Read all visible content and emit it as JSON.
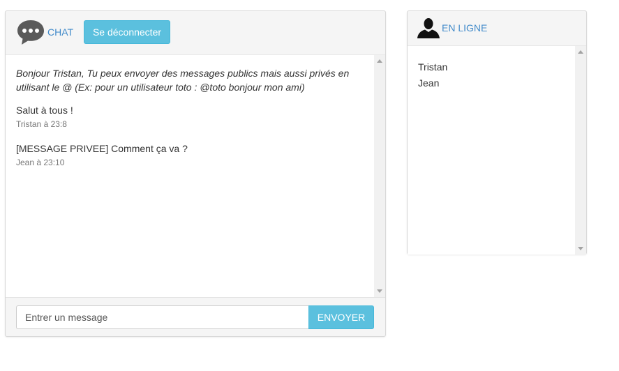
{
  "chat": {
    "title": "CHAT",
    "logout_label": "Se déconnecter",
    "welcome": "Bonjour Tristan, Tu peux envoyer des messages publics mais aussi privés en utilisant le @ (Ex: pour un utilisateur toto : @toto bonjour mon ami)",
    "messages": [
      {
        "text": "Salut à tous !",
        "meta": "Tristan à 23:8"
      },
      {
        "text": "[MESSAGE PRIVEE] Comment ça va ?",
        "meta": "Jean à 23:10"
      }
    ],
    "input_placeholder": "Entrer un message",
    "send_label": "ENVOYER"
  },
  "online": {
    "title": "EN LIGNE",
    "users": [
      "Tristan",
      "Jean"
    ]
  },
  "colors": {
    "accent": "#5bc0de",
    "link": "#428bca",
    "panel_bg": "#f5f5f5"
  },
  "icons": {
    "chat": "speech-bubble-icon",
    "online": "user-silhouette-icon"
  }
}
